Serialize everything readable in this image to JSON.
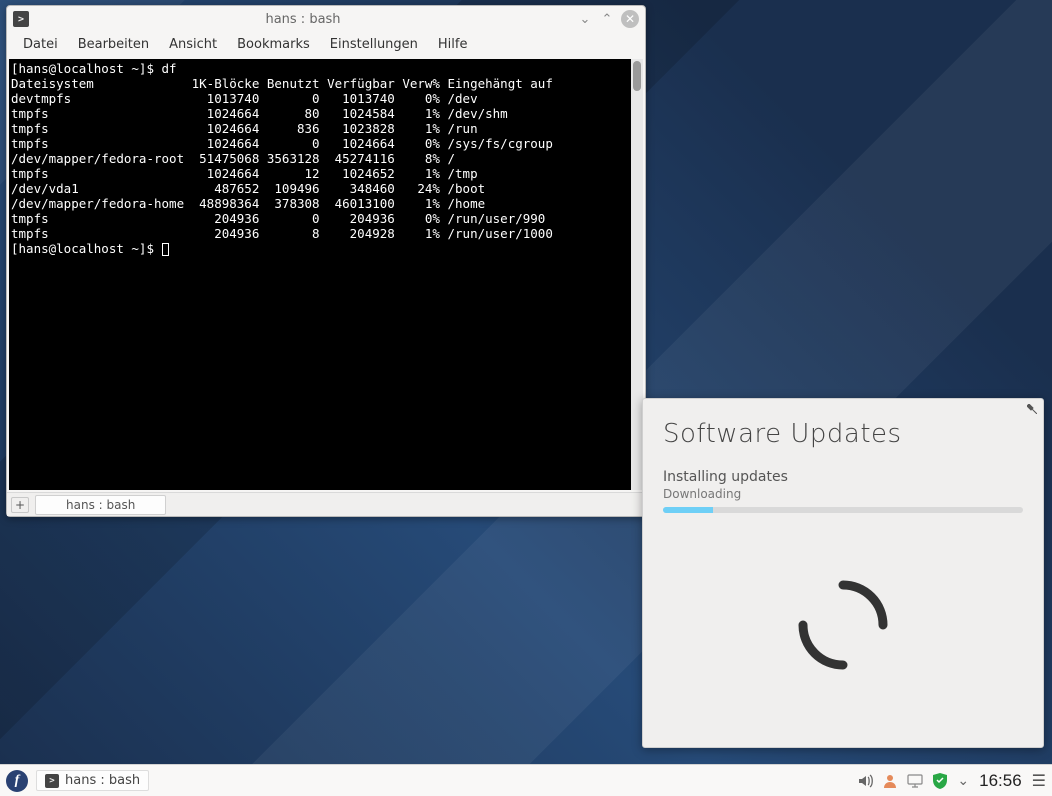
{
  "terminal": {
    "title": "hans : bash",
    "menus": [
      "Datei",
      "Bearbeiten",
      "Ansicht",
      "Bookmarks",
      "Einstellungen",
      "Hilfe"
    ],
    "prompt": "[hans@localhost ~]$ ",
    "command": "df",
    "header": {
      "fs": "Dateisystem",
      "blocks": "1K-Blöcke",
      "used": "Benutzt",
      "avail": "Verfügbar",
      "usep": "Verw%",
      "mount": "Eingehängt auf"
    },
    "rows": [
      {
        "fs": "devtmpfs",
        "blocks": "1013740",
        "used": "0",
        "avail": "1013740",
        "usep": "0%",
        "mount": "/dev"
      },
      {
        "fs": "tmpfs",
        "blocks": "1024664",
        "used": "80",
        "avail": "1024584",
        "usep": "1%",
        "mount": "/dev/shm"
      },
      {
        "fs": "tmpfs",
        "blocks": "1024664",
        "used": "836",
        "avail": "1023828",
        "usep": "1%",
        "mount": "/run"
      },
      {
        "fs": "tmpfs",
        "blocks": "1024664",
        "used": "0",
        "avail": "1024664",
        "usep": "0%",
        "mount": "/sys/fs/cgroup"
      },
      {
        "fs": "/dev/mapper/fedora-root",
        "blocks": "51475068",
        "used": "3563128",
        "avail": "45274116",
        "usep": "8%",
        "mount": "/"
      },
      {
        "fs": "tmpfs",
        "blocks": "1024664",
        "used": "12",
        "avail": "1024652",
        "usep": "1%",
        "mount": "/tmp"
      },
      {
        "fs": "/dev/vda1",
        "blocks": "487652",
        "used": "109496",
        "avail": "348460",
        "usep": "24%",
        "mount": "/boot"
      },
      {
        "fs": "/dev/mapper/fedora-home",
        "blocks": "48898364",
        "used": "378308",
        "avail": "46013100",
        "usep": "1%",
        "mount": "/home"
      },
      {
        "fs": "tmpfs",
        "blocks": "204936",
        "used": "0",
        "avail": "204936",
        "usep": "0%",
        "mount": "/run/user/990"
      },
      {
        "fs": "tmpfs",
        "blocks": "204936",
        "used": "8",
        "avail": "204928",
        "usep": "1%",
        "mount": "/run/user/1000"
      }
    ],
    "tab_label": "hans : bash"
  },
  "notification": {
    "title": "Software Updates",
    "status1": "Installing updates",
    "status2": "Downloading",
    "progress_percent": 14
  },
  "panel": {
    "task": "hans : bash",
    "clock": "16:56"
  },
  "icons": {
    "volume": "🔊",
    "user": "⾓",
    "display": "🖵",
    "shield": "✔",
    "chevron": "⌄",
    "burger": "☰",
    "pin": "📌",
    "minimize": "⌄",
    "maximize": "⌃",
    "close": "✕",
    "plus": "+"
  }
}
